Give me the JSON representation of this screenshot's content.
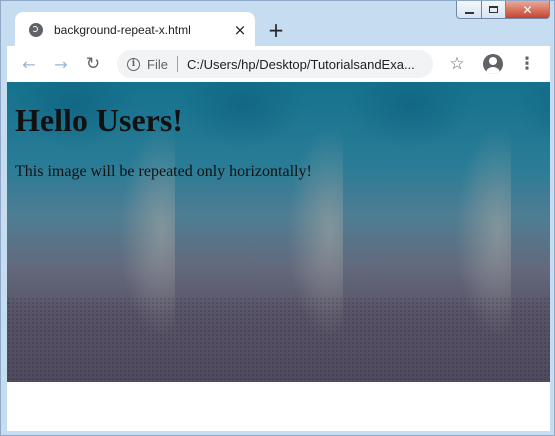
{
  "browser": {
    "tab_title": "background-repeat-x.html",
    "tab_close_icon": "×",
    "new_tab_icon": "+",
    "back_icon": "←",
    "forward_icon": "→",
    "reload_icon": "↻",
    "info_icon": "i",
    "scheme_label": "File",
    "url": "C:/Users/hp/Desktop/TutorialsandExa...",
    "star_icon": "☆",
    "menu_icon": "⋮"
  },
  "window_controls": {
    "close_icon": "✕"
  },
  "page": {
    "heading": "Hello Users!",
    "text": "This image will be repeated only horizontally!"
  }
}
